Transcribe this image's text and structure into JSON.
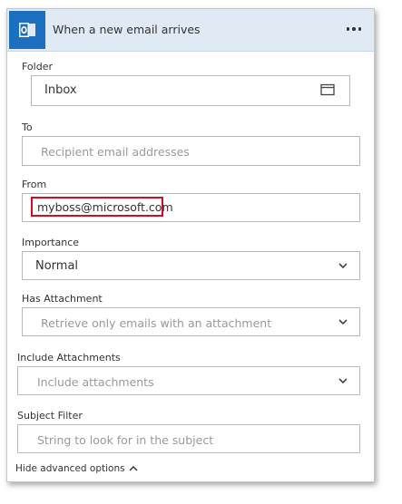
{
  "header": {
    "title": "When a new email arrives",
    "icon": "outlook-icon",
    "accent": "#1c6fbf"
  },
  "fields": {
    "folder": {
      "label": "Folder",
      "value": "Inbox",
      "icon": "folder-picker-icon"
    },
    "to": {
      "label": "To",
      "placeholder": "Recipient email addresses"
    },
    "from": {
      "label": "From",
      "value": "myboss@microsoft.com",
      "highlight_color": "#d10f24"
    },
    "importance": {
      "label": "Importance",
      "value": "Normal"
    },
    "has_attachment": {
      "label": "Has Attachment",
      "placeholder": "Retrieve only emails with an attachment"
    },
    "include_attachments": {
      "label": "Include Attachments",
      "placeholder": "Include attachments"
    },
    "subject_filter": {
      "label": "Subject Filter",
      "placeholder": "String to look for in the subject"
    }
  },
  "footer": {
    "hide_advanced_label": "Hide advanced options"
  }
}
